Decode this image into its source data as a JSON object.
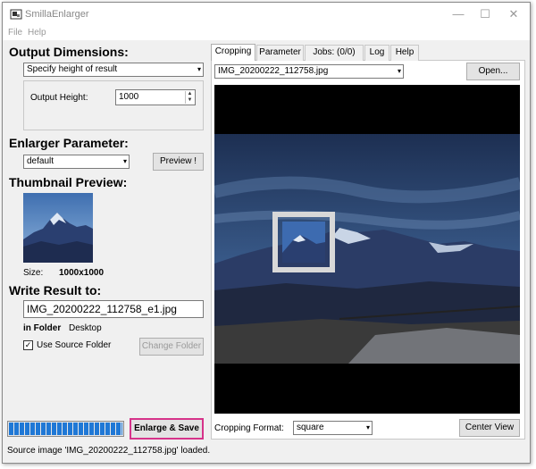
{
  "window": {
    "title": "SmillaEnlarger",
    "minimize": "—",
    "maximize": "☐",
    "close": "✕"
  },
  "menu": {
    "items": [
      "File",
      "Help"
    ]
  },
  "output_dimensions": {
    "title": "Output Dimensions:",
    "mode_value": "Specify height of result",
    "height_label": "Output Height:",
    "height_value": "1000"
  },
  "enlarger": {
    "title": "Enlarger Parameter:",
    "preset_value": "default",
    "preview_button": "Preview !"
  },
  "thumbnail": {
    "title": "Thumbnail Preview:",
    "size_label": "Size:",
    "size_value": "1000x1000"
  },
  "write_result": {
    "title": "Write Result to:",
    "filename": "IMG_20200222_112758_e1.jpg",
    "folder_label": "in Folder",
    "folder_value": "Desktop",
    "use_source_label": "Use Source Folder",
    "use_source_checked": true,
    "change_folder_button": "Change Folder"
  },
  "tabs": [
    {
      "label": "Cropping",
      "active": true
    },
    {
      "label": "Parameter",
      "active": false
    },
    {
      "label": "Jobs: (0/0)",
      "active": false
    },
    {
      "label": "Log",
      "active": false
    },
    {
      "label": "Help",
      "active": false
    }
  ],
  "cropping": {
    "file_value": "IMG_20200222_112758.jpg",
    "open_button": "Open...",
    "format_label": "Cropping Format:",
    "format_value": "square",
    "center_button": "Center View"
  },
  "progress": {
    "fraction": 1.0
  },
  "enlarge_button": "Enlarge & Save",
  "status_text": "Source image 'IMG_20200222_112758.jpg' loaded.",
  "colors": {
    "accent_highlight": "#d6338a",
    "progress": "#1f78d6"
  },
  "icons": {
    "dropdown": "▾",
    "checkmark": "✓",
    "spin_up": "▲",
    "spin_down": "▼"
  }
}
